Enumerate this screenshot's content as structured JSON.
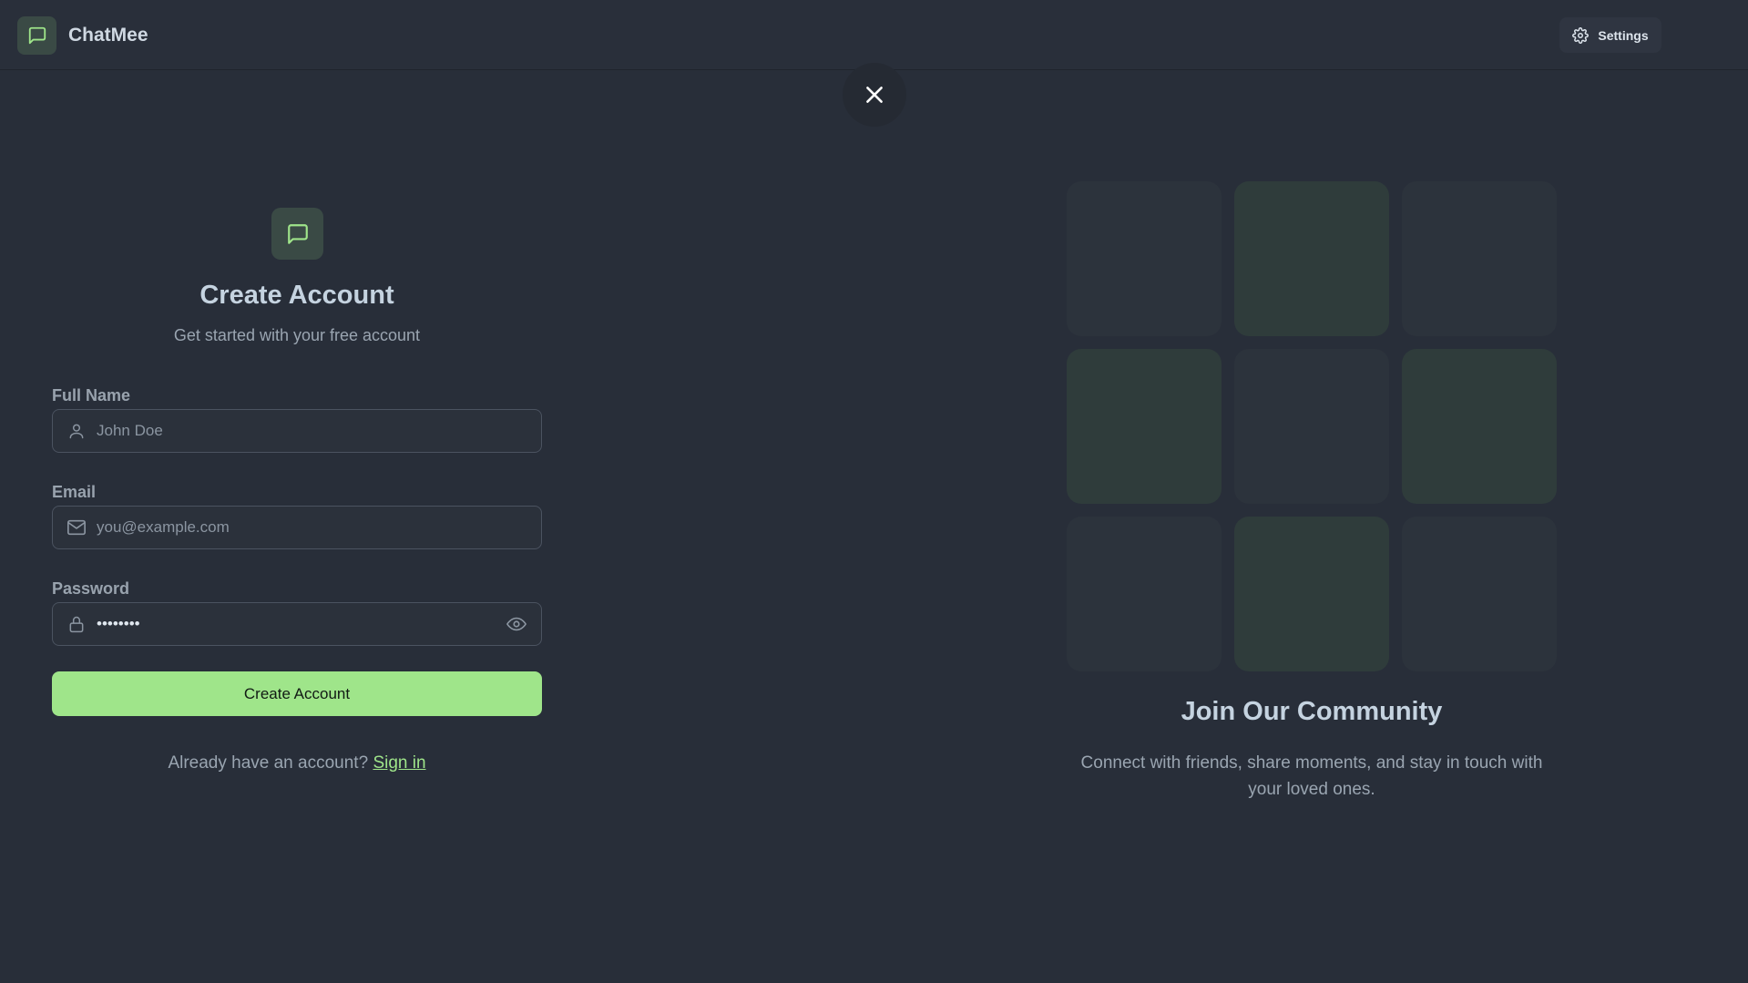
{
  "header": {
    "brand_name": "ChatMee",
    "settings_label": "Settings"
  },
  "form": {
    "title": "Create Account",
    "subtitle": "Get started with your free account",
    "fields": {
      "full_name": {
        "label": "Full Name",
        "placeholder": "John Doe",
        "icon": "user-icon"
      },
      "email": {
        "label": "Email",
        "placeholder": "you@example.com",
        "icon": "mail-icon"
      },
      "password": {
        "label": "Password",
        "value": "••••••••",
        "icon": "lock-icon",
        "toggle_icon": "eye-icon"
      }
    },
    "submit_label": "Create Account",
    "signin_prompt": "Already have an account?",
    "signin_link": "Sign in"
  },
  "community": {
    "title": "Join Our Community",
    "text": "Connect with friends, share moments, and stay in touch with your loved ones."
  },
  "colors": {
    "background": "#282e39",
    "accent": "#9fe58a",
    "tile_dim": "#2c333c",
    "tile_green": "#2f3c3b"
  }
}
